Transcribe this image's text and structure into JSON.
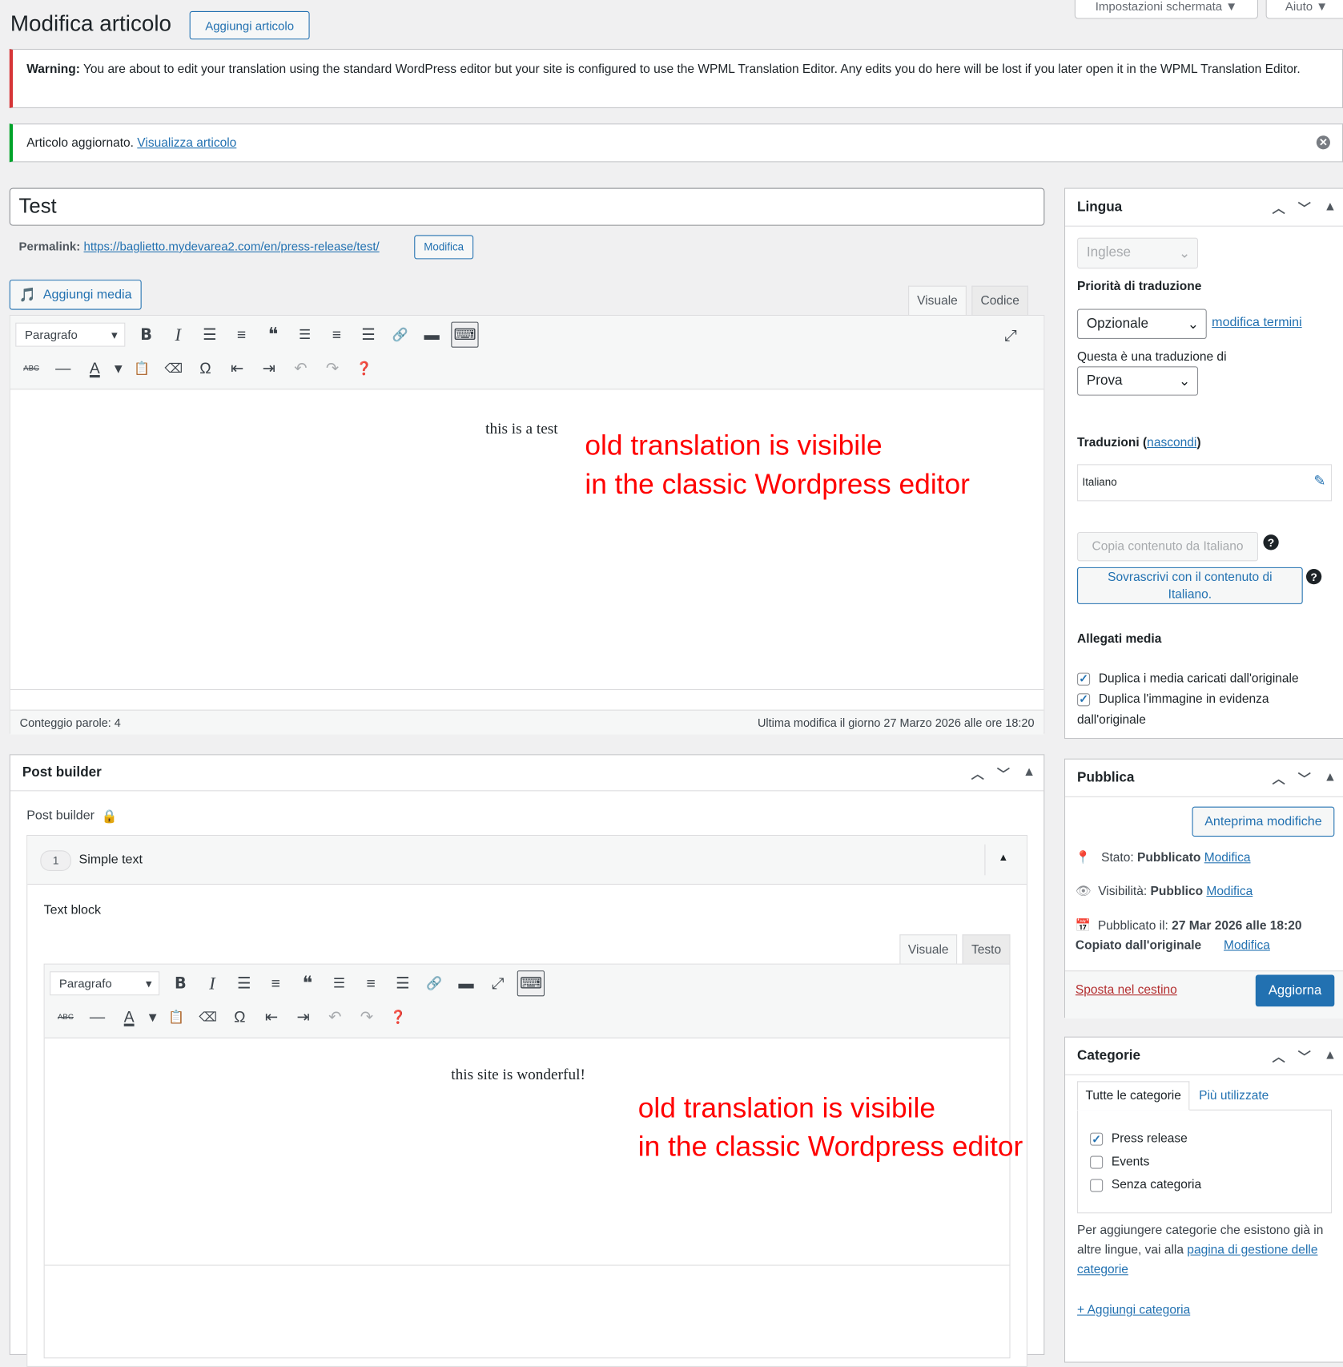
{
  "header": {
    "title": "Modifica articolo",
    "add_button": "Aggiungi articolo",
    "screen_options": "Impostazioni schermata ▼",
    "help": "Aiuto ▼"
  },
  "warning": {
    "label": "Warning:",
    "text": " You are about to edit your translation using the standard WordPress editor but your site is configured to use the WPML Translation Editor. Any edits you do here will be lost if you later open it in the WPML Translation Editor."
  },
  "success": {
    "text": "Articolo aggiornato. ",
    "link": "Visualizza articolo"
  },
  "post": {
    "title": "Test",
    "permalink_label": "Permalink:",
    "permalink_url": "https://baglietto.mydevarea2.com/en/press-release/test/",
    "permalink_edit": "Modifica",
    "add_media": "Aggiungi media",
    "tab_visual": "Visuale",
    "tab_code": "Codice",
    "format": "Paragrafo",
    "content": "this is a test",
    "word_count": "Conteggio parole: 4",
    "last_modified": "Ultima modifica il giorno 27 Marzo 2026 alle ore 18:20"
  },
  "toolbar_row1": [
    "bold",
    "italic",
    "bullet-list",
    "numbered-list",
    "blockquote",
    "align-left",
    "align-center",
    "align-right",
    "link",
    "read-more",
    "toolbar-toggle"
  ],
  "toolbar_row2": [
    "strikethrough",
    "horizontal-line",
    "text-color",
    "color-dropdown",
    "paste-text",
    "clear-formatting",
    "special-character",
    "outdent",
    "indent",
    "undo",
    "redo",
    "help"
  ],
  "annotation": {
    "line1": "old translation is visibile",
    "line2": "in the classic Wordpress editor"
  },
  "post_builder": {
    "title": "Post builder",
    "label": "Post builder",
    "block_index": "1",
    "block_title": "Simple text",
    "field_label": "Text block",
    "tab_visual": "Visuale",
    "tab_text": "Testo",
    "format": "Paragrafo",
    "content": "this site is wonderful!"
  },
  "lingua": {
    "title": "Lingua",
    "language": "Inglese",
    "priority_label": "Priorità di traduzione",
    "priority": "Opzionale",
    "edit_terms": "modifica termini",
    "translation_of_label": "Questa è una traduzione di",
    "translation_of": "Prova",
    "translations_label": "Traduzioni (",
    "hide": "nascondi",
    "translations_close": ")",
    "translation_item": "Italiano",
    "copy_button": "Copia contenuto da Italiano",
    "overwrite_button": "Sovrascrivi con il contenuto di Italiano.",
    "media_label": "Allegati media",
    "dup_media": "Duplica i media caricati dall'originale",
    "dup_featured": "Duplica l'immagine in evidenza dall'originale"
  },
  "pubblica": {
    "title": "Pubblica",
    "preview": "Anteprima modifiche",
    "status_label": "Stato: ",
    "status": "Pubblicato",
    "visibility_label": "Visibilità: ",
    "visibility": "Pubblico",
    "published_label": "Pubblicato il: ",
    "published": "27 Mar 2026 alle 18:20",
    "copied": "Copiato dall'originale",
    "edit": "Modifica",
    "trash": "Sposta nel cestino",
    "update": "Aggiorna"
  },
  "categorie": {
    "title": "Categorie",
    "tab_all": "Tutte le categorie",
    "tab_most": "Più utilizzate",
    "items": [
      {
        "label": "Press release",
        "checked": true
      },
      {
        "label": "Events",
        "checked": false
      },
      {
        "label": "Senza categoria",
        "checked": false
      }
    ],
    "note": "Per aggiungere categorie che esistono già in altre lingue, vai alla ",
    "note_link": "pagina di gestione delle categorie",
    "add": "+ Aggiungi categoria"
  }
}
